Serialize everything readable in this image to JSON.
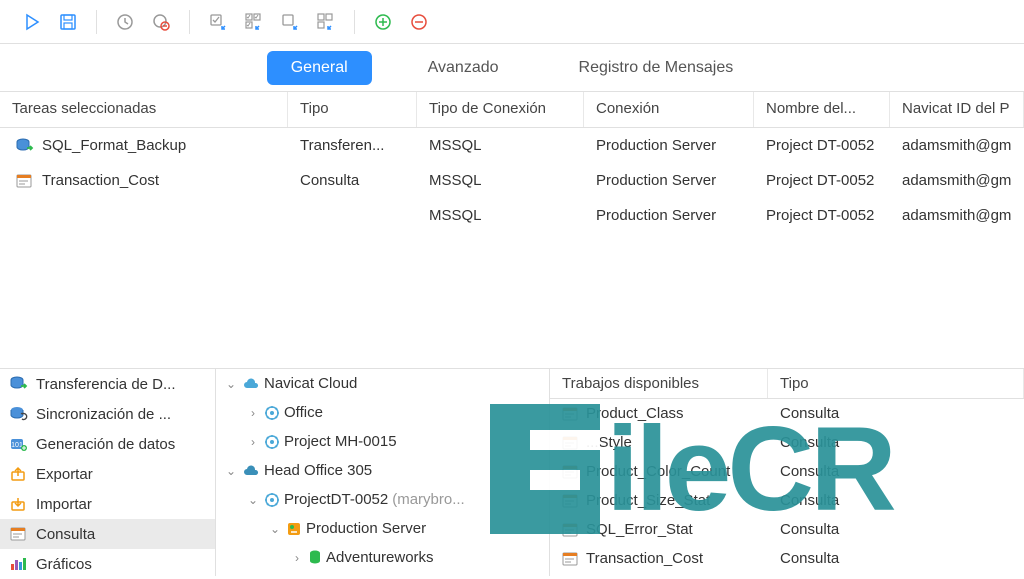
{
  "toolbar": {},
  "tabs": {
    "general": "General",
    "advanced": "Avanzado",
    "log": "Registro de Mensajes",
    "active": "general"
  },
  "grid": {
    "headers": {
      "tasks": "Tareas seleccionadas",
      "type": "Tipo",
      "conntype": "Tipo de Conexión",
      "conn": "Conexión",
      "name": "Nombre del...",
      "navicat": "Navicat ID del P"
    },
    "rows": [
      {
        "task": "SQL_Format_Backup",
        "type": "Transferen...",
        "conntype": "MSSQL",
        "conn": "Production Server",
        "name": "Project DT-0052",
        "navicat": "adamsmith@gm",
        "icon": "transfer"
      },
      {
        "task": "Transaction_Cost",
        "type": "Consulta",
        "conntype": "MSSQL",
        "conn": "Production Server",
        "name": "Project DT-0052",
        "navicat": "adamsmith@gm",
        "icon": "query"
      },
      {
        "task": "",
        "type": "",
        "conntype": "MSSQL",
        "conn": "Production Server",
        "name": "Project DT-0052",
        "navicat": "adamsmith@gm",
        "icon": ""
      }
    ]
  },
  "leftPanel": [
    {
      "label": "Transferencia de D...",
      "icon": "transfer",
      "sel": false
    },
    {
      "label": "Sincronización de ...",
      "icon": "sync",
      "sel": false
    },
    {
      "label": "Generación de datos",
      "icon": "gen",
      "sel": false
    },
    {
      "label": "Exportar",
      "icon": "export",
      "sel": false
    },
    {
      "label": "Importar",
      "icon": "import",
      "sel": false
    },
    {
      "label": "Consulta",
      "icon": "query",
      "sel": true
    },
    {
      "label": "Gráficos",
      "icon": "chart",
      "sel": false
    }
  ],
  "tree": [
    {
      "indent": 0,
      "caret": "open",
      "icon": "cloud",
      "label": "Navicat Cloud",
      "suffix": ""
    },
    {
      "indent": 1,
      "caret": "closed",
      "icon": "gear",
      "label": "Office",
      "suffix": ""
    },
    {
      "indent": 1,
      "caret": "closed",
      "icon": "gear",
      "label": "Project MH-0015",
      "suffix": ""
    },
    {
      "indent": 0,
      "caret": "open",
      "icon": "cloud2",
      "label": "Head Office 305",
      "suffix": ""
    },
    {
      "indent": 1,
      "caret": "open",
      "icon": "gear",
      "label": "ProjectDT-0052",
      "suffix": "(marybro..."
    },
    {
      "indent": 2,
      "caret": "open",
      "icon": "server",
      "label": "Production Server",
      "suffix": ""
    },
    {
      "indent": 3,
      "caret": "closed",
      "icon": "db",
      "label": "Adventureworks",
      "suffix": ""
    }
  ],
  "rightPanel": {
    "headers": {
      "jobs": "Trabajos disponibles",
      "type": "Tipo"
    },
    "rows": [
      {
        "label": "Product_Class",
        "type": "Consulta"
      },
      {
        "label": "...Style",
        "type": "Consulta"
      },
      {
        "label": "Product_Color_Count",
        "type": "Consulta"
      },
      {
        "label": "Product_Size_Stat",
        "type": "Consulta"
      },
      {
        "label": "SQL_Error_Stat",
        "type": "Consulta"
      },
      {
        "label": "Transaction_Cost",
        "type": "Consulta"
      }
    ]
  },
  "watermark": "ileCR"
}
